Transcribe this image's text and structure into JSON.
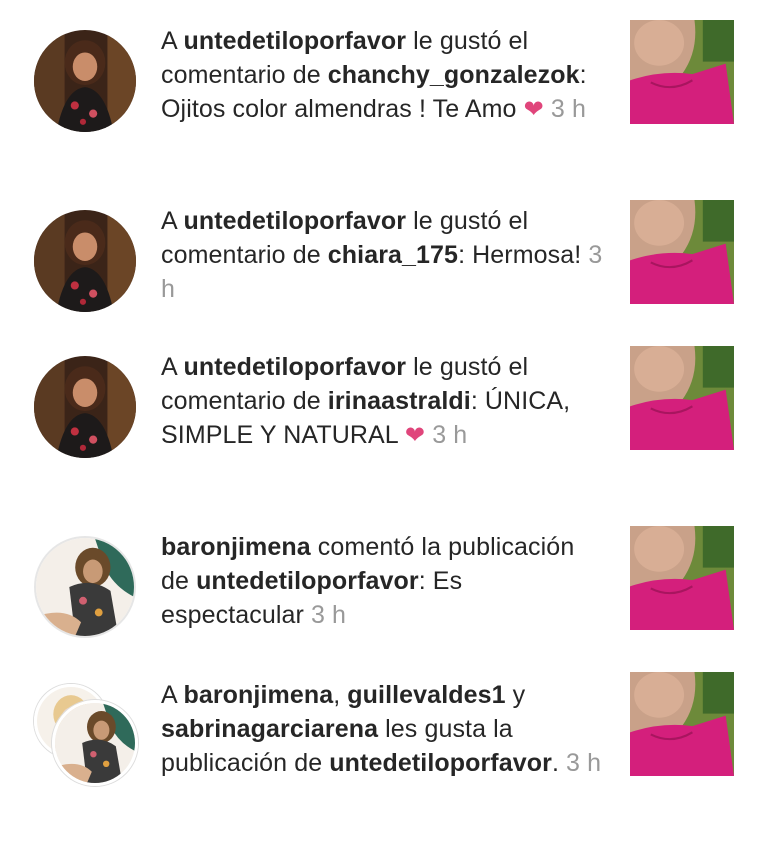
{
  "notifications": [
    {
      "prefix": "A ",
      "user": "untedetiloporfavor",
      "text1": " le gustó el comentario de ",
      "user2": "chanchy_gonzalezok",
      "text2": ": Ojitos color almendras ! Te Amo ",
      "heart": "❤",
      "time": "3 h"
    },
    {
      "prefix": "A ",
      "user": "untedetiloporfavor",
      "text1": " le gustó el comentario de ",
      "user2": "chiara_175",
      "text2": ": Hermosa! ",
      "time": "3 h"
    },
    {
      "prefix": "A ",
      "user": "untedetiloporfavor",
      "text1": " le gustó el comentario de ",
      "user2": "irinaastraldi",
      "text2": ": ÚNICA, SIMPLE Y NATURAL ",
      "heart": "❤",
      "time": "3 h"
    },
    {
      "user": "baronjimena",
      "text1": " comentó la publicación de ",
      "user2": "untedetiloporfavor",
      "text2": ": Es espectacular ",
      "time": "3 h"
    },
    {
      "prefix": "A ",
      "user": "baronjimena",
      "sep1": ", ",
      "user2": "guillevaldes1",
      "sep2": " y ",
      "user3": "sabrinagarciarena",
      "text1": " les gusta la publicación de ",
      "user4": "untedetiloporfavor",
      "text2": ". ",
      "time": "3 h"
    }
  ],
  "colors": {
    "username": "#262626",
    "timestamp": "#999999",
    "heart": "#e0457b",
    "thumbnail_dress": "#d41f7c"
  },
  "icons": {
    "heart": "heart-icon"
  }
}
